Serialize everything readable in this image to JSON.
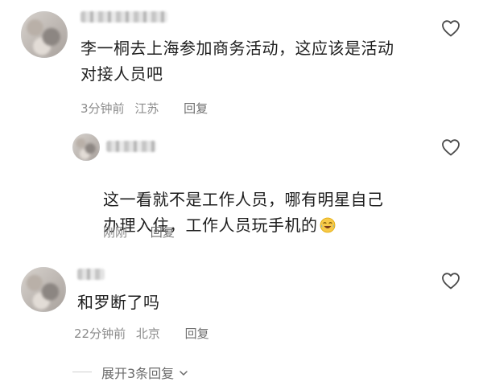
{
  "comments": [
    {
      "text": "李一桐去上海参加商务活动，这应该是活动\n对接人员吧",
      "time": "3分钟前",
      "location": "江苏",
      "reply_label": "回复"
    },
    {
      "text": "这一看就不是工作人员，哪有明星自己\n办理入住，工作人员玩手机的",
      "time": "刚刚",
      "location": "",
      "reply_label": "回复",
      "emoji": "laughing-tears-emoji"
    },
    {
      "text": "和罗断了吗",
      "time": "22分钟前",
      "location": "北京",
      "reply_label": "回复"
    }
  ],
  "expand_replies": {
    "label": "展开3条回复"
  },
  "icons": {
    "like": "heart-outline-icon",
    "expand": "chevron-down-icon"
  },
  "colors": {
    "text": "#1e1e1e",
    "meta": "#8b8b8b",
    "icon": "#4a4a4a"
  }
}
